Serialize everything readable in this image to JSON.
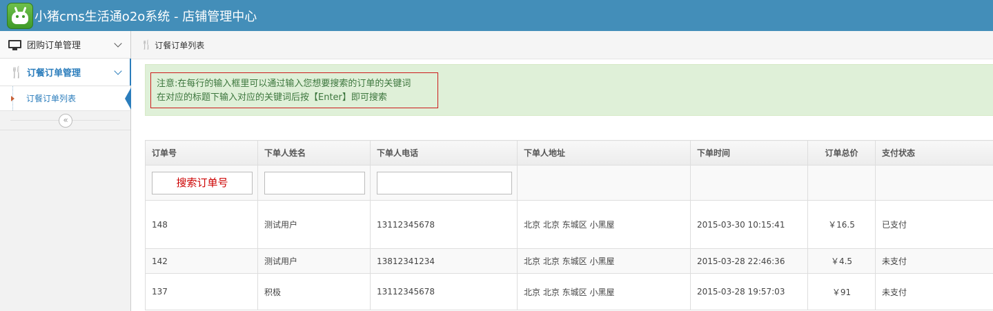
{
  "header": {
    "title": "小猪cms生活通o2o系统 - 店铺管理中心"
  },
  "sidebar": {
    "items": [
      {
        "label": "团购订单管理",
        "icon": "monitor-icon"
      },
      {
        "label": "订餐订单管理",
        "icon": "cutlery-icon"
      }
    ],
    "sub_items": [
      {
        "label": "订餐订单列表"
      }
    ],
    "collapse_glyph": "«"
  },
  "breadcrumb": {
    "icon": "cutlery-icon",
    "label": "订餐订单列表"
  },
  "notice": {
    "line1": "注意:在每行的输入框里可以通过输入您想要搜索的订单的关键词",
    "line2": "在对应的标题下输入对应的关键词后按【Enter】即可搜索"
  },
  "table": {
    "headers": [
      "订单号",
      "下单人姓名",
      "下单人电话",
      "下单人地址",
      "下单时间",
      "订单总价",
      "支付状态"
    ],
    "filter_placeholder": "搜索订单号",
    "rows": [
      {
        "id": "148",
        "name": "测试用户",
        "phone": "13112345678",
        "address": "北京 北京 东城区 小黑屋",
        "time": "2015-03-30 10:15:41",
        "total": "￥16.5",
        "status": "已支付"
      },
      {
        "id": "142",
        "name": "测试用户",
        "phone": "13812341234",
        "address": "北京 北京 东城区 小黑屋",
        "time": "2015-03-28 22:46:36",
        "total": "￥4.5",
        "status": "未支付"
      },
      {
        "id": "137",
        "name": "积极",
        "phone": "13112345678",
        "address": "北京 北京 东城区 小黑屋",
        "time": "2015-03-28 19:57:03",
        "total": "￥91",
        "status": "未支付"
      }
    ]
  },
  "colors": {
    "header_bg": "#438eb9",
    "accent": "#2b7dbc",
    "alert_bg": "#dff0d8",
    "notice_border": "#cc1a1a"
  }
}
